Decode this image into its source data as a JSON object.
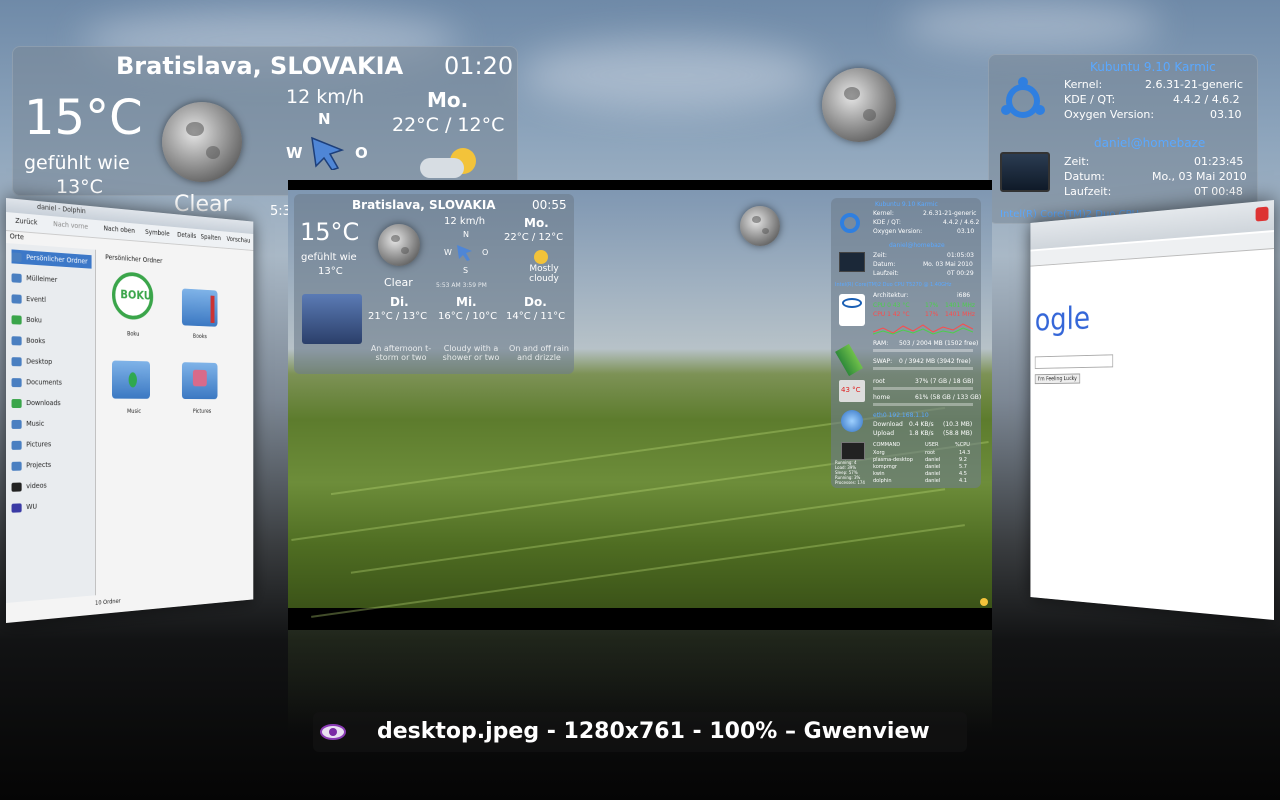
{
  "weather_large": {
    "location": "Bratislava, SLOVAKIA",
    "time": "01:20",
    "temp": "15°C",
    "feels_label": "gefühlt wie",
    "feels_value": "13°C",
    "condition": "Clear",
    "wind_speed": "12 km/h",
    "wind_dir_n": "N",
    "wind_dir_w": "W",
    "wind_dir_o": "O",
    "day": "Mo.",
    "day_temp": "22°C / 12°C",
    "edge_text": "5:3"
  },
  "sysinfo_large": {
    "distro": "Kubuntu 9.10 Karmic",
    "kernel_label": "Kernel:",
    "kernel_value": "2.6.31-21-generic",
    "kde_label": "KDE / QT:",
    "kde_value": "4.4.2 / 4.6.2",
    "oxygen_label": "Oxygen Version:",
    "oxygen_value": "03.10",
    "user": "daniel@homebaze",
    "zeit_label": "Zeit:",
    "zeit_value": "01:23:45",
    "datum_label": "Datum:",
    "datum_value": "Mo., 03 Mai 2010",
    "laufzeit_label": "Laufzeit:",
    "laufzeit_value": "0T 00:48",
    "cpu": "Intel(R) Core(TM)2 Duo CPU",
    "arch": "Archit"
  },
  "dolphin": {
    "title": "daniel - Dolphin",
    "back": "Zurück",
    "forward": "Nach vorne",
    "up": "Nach oben",
    "symbols": "Symbole",
    "details": "Details",
    "columns": "Spalten",
    "search": "Vorschau",
    "places_label": "Orte",
    "breadcrumb": "Persönlicher Ordner",
    "sidebar": [
      "Persönlicher Ordner",
      "Mülleimer",
      "Eventl",
      "Boku",
      "Books",
      "Desktop",
      "Documents",
      "Downloads",
      "Music",
      "Pictures",
      "Projects",
      "videos",
      "WU"
    ],
    "files": [
      "Boku",
      "Books",
      "Music",
      "Pictures"
    ],
    "boku_logo": "BOKU",
    "status": "10 Ordner"
  },
  "browser": {
    "google": "ogle",
    "lucky": "I'm Feeling Lucky"
  },
  "mini_weather": {
    "location": "Bratislava, SLOVAKIA",
    "time": "00:55",
    "temp": "15°C",
    "feels_label": "gefühlt wie",
    "feels_value": "13°C",
    "condition": "Clear",
    "wind_speed": "12 km/h",
    "wind_n": "N",
    "wind_w": "W",
    "wind_o": "O",
    "wind_s": "S",
    "updated": "5:53 AM 3:59 PM",
    "forecast": [
      {
        "day": "Mo.",
        "temp": "22°C / 12°C",
        "desc": "Mostly cloudy"
      },
      {
        "day": "Di.",
        "temp": "21°C / 13°C",
        "desc": "An afternoon t-storm or two"
      },
      {
        "day": "Mi.",
        "temp": "16°C / 10°C",
        "desc": "Cloudy with a shower or two"
      },
      {
        "day": "Do.",
        "temp": "14°C / 11°C",
        "desc": "On and off rain and drizzle"
      }
    ]
  },
  "mini_sys": {
    "distro": "Kubuntu 9.10 Karmic",
    "rows1": [
      [
        "Kernel:",
        "2.6.31-21-generic"
      ],
      [
        "KDE / QT:",
        "4.4.2 / 4.6.2"
      ],
      [
        "Oxygen Version:",
        "03.10"
      ]
    ],
    "user": "daniel@homebaze",
    "rows2": [
      [
        "Zeit:",
        "01:05:03"
      ],
      [
        "Datum:",
        "Mo. 03 Mai 2010"
      ],
      [
        "Laufzeit:",
        "0T 00:29"
      ]
    ],
    "cpu_head": "Intel(R) Core(TM)2 Duo CPU   T5270 @ 1.40GHz",
    "arch": [
      "Architektur:",
      "i686"
    ],
    "cpu0": [
      "CPU 0   43 °C",
      "17%",
      "1401 MHz"
    ],
    "cpu1": [
      "CPU 1   42 °C",
      "17%",
      "1401 MHz"
    ],
    "ram": [
      "RAM:",
      "503 / 2004 MB (1502 free)"
    ],
    "swap": [
      "SWAP:",
      "0 / 3942 MB (3942 free)"
    ],
    "temp": "43 °C",
    "root": [
      "root",
      "37% (7 GB / 18 GB)"
    ],
    "home": [
      "home",
      "61% (58 GB / 133 GB)"
    ],
    "net_head": "eth0 192.168.1.10",
    "download": [
      "Download",
      "0.4 KB/s",
      "(10.3 MB)"
    ],
    "upload": [
      "Upload",
      "1.8 KB/s",
      "(58.8 MB)"
    ],
    "proc_head": [
      "COMMAND",
      "USER",
      "%CPU"
    ],
    "procs": [
      [
        "Xorg",
        "root",
        "14.3"
      ],
      [
        "plasma-desktop",
        "daniel",
        "9.2"
      ],
      [
        "kompmgr",
        "daniel",
        "5.7"
      ],
      [
        "kwin",
        "daniel",
        "4.5"
      ],
      [
        "dolphin",
        "daniel",
        "4.1"
      ]
    ],
    "stats": [
      "Running: 4",
      "Load: 39%",
      "Sleep: 57%",
      "Running: 3%",
      "Processes: 174"
    ]
  },
  "caption": {
    "text": "desktop.jpeg - 1280x761 - 100% – Gwenview"
  },
  "colors": {
    "accent_blue": "#5aa8ff",
    "cpu_red": "#ff4a4a",
    "cpu_green": "#4ccf4c"
  }
}
